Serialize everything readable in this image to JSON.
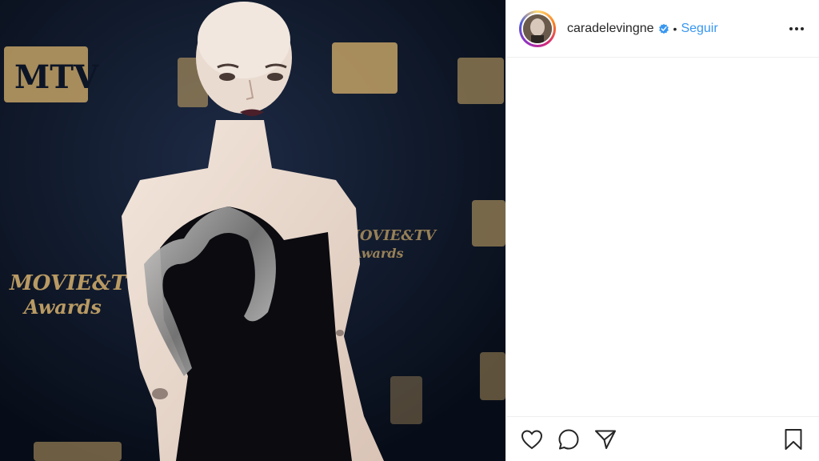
{
  "post": {
    "username": "caradelevingne",
    "verified": true,
    "separator": "•",
    "follow_label": "Seguir"
  },
  "media": {
    "backdrop_text": [
      "MTV",
      "MOVIE&TV",
      "Awards"
    ]
  },
  "icons": {
    "verified": "verified-badge-icon",
    "more": "more-options-icon",
    "like": "heart-icon",
    "comment": "comment-icon",
    "share": "send-icon",
    "save": "bookmark-icon"
  },
  "colors": {
    "follow": "#3897f0",
    "verified": "#3897f0",
    "text": "#262626",
    "border": "#efefef"
  }
}
